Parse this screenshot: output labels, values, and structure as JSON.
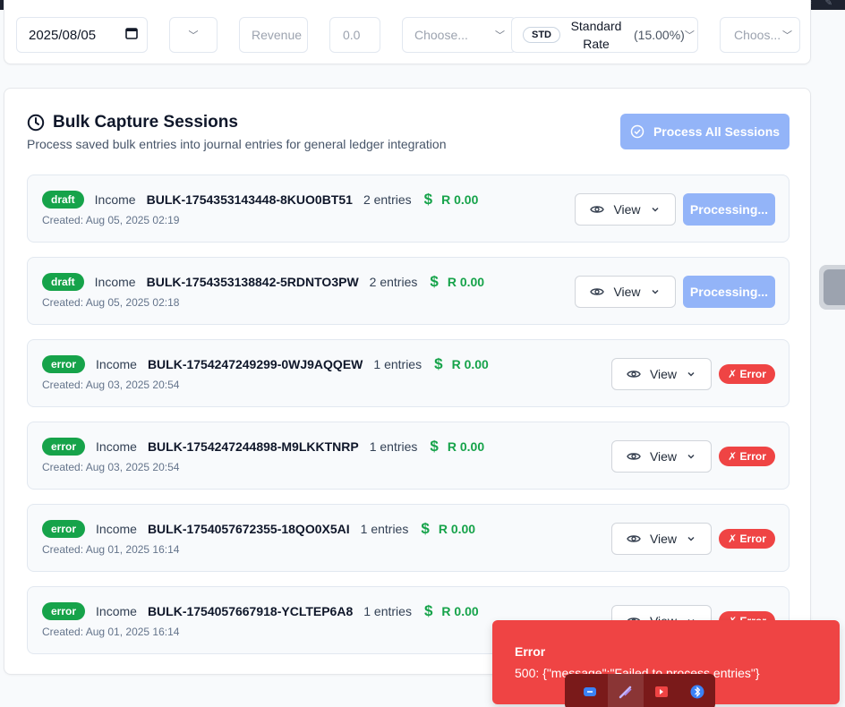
{
  "filters": {
    "date_value": "2025/08/05",
    "revenue_placeholder": "Revenue",
    "amount_placeholder": "0.0",
    "choose_1": "Choose...",
    "tax_badge": "STD",
    "tax_name": "Standard Rate",
    "tax_rate": "(15.00%)",
    "choose_2": "Choos..."
  },
  "card": {
    "title": "Bulk Capture Sessions",
    "subtitle": "Process saved bulk entries into journal entries for general ledger integration",
    "process_all_label": "Process All Sessions"
  },
  "sessions": [
    {
      "status": "draft",
      "type": "Income",
      "ref": "BULK-1754353143448-8KUO0BT51",
      "entries": "2 entries",
      "currency_icon": "$",
      "amount": "R 0.00",
      "created": "Created: Aug 05, 2025 02:19",
      "view_label": "View",
      "action_label": "Processing..."
    },
    {
      "status": "draft",
      "type": "Income",
      "ref": "BULK-1754353138842-5RDNTO3PW",
      "entries": "2 entries",
      "currency_icon": "$",
      "amount": "R 0.00",
      "created": "Created: Aug 05, 2025 02:18",
      "view_label": "View",
      "action_label": "Processing..."
    },
    {
      "status": "error",
      "type": "Income",
      "ref": "BULK-1754247249299-0WJ9AQQEW",
      "entries": "1 entries",
      "currency_icon": "$",
      "amount": "R 0.00",
      "created": "Created: Aug 03, 2025 20:54",
      "view_label": "View",
      "action_label": "✗ Error"
    },
    {
      "status": "error",
      "type": "Income",
      "ref": "BULK-1754247244898-M9LKKTNRP",
      "entries": "1 entries",
      "currency_icon": "$",
      "amount": "R 0.00",
      "created": "Created: Aug 03, 2025 20:54",
      "view_label": "View",
      "action_label": "✗ Error"
    },
    {
      "status": "error",
      "type": "Income",
      "ref": "BULK-1754057672355-18QO0X5AI",
      "entries": "1 entries",
      "currency_icon": "$",
      "amount": "R 0.00",
      "created": "Created: Aug 01, 2025 16:14",
      "view_label": "View",
      "action_label": "✗ Error"
    },
    {
      "status": "error",
      "type": "Income",
      "ref": "BULK-1754057667918-YCLTEP6A8",
      "entries": "1 entries",
      "currency_icon": "$",
      "amount": "R 0.00",
      "created": "Created: Aug 01, 2025 16:14",
      "view_label": "View",
      "action_label": "✗ Error"
    }
  ],
  "toast": {
    "title": "Error",
    "message": "500: {\"message\":\"Failed to process entries\"}"
  },
  "colors": {
    "accent_disabled": "#93b4f8",
    "success": "#16a34a",
    "danger": "#ef4444"
  },
  "tray_icons": [
    "cloud-sync-icon",
    "feather-pen-icon",
    "record-icon",
    "bluetooth-icon"
  ]
}
